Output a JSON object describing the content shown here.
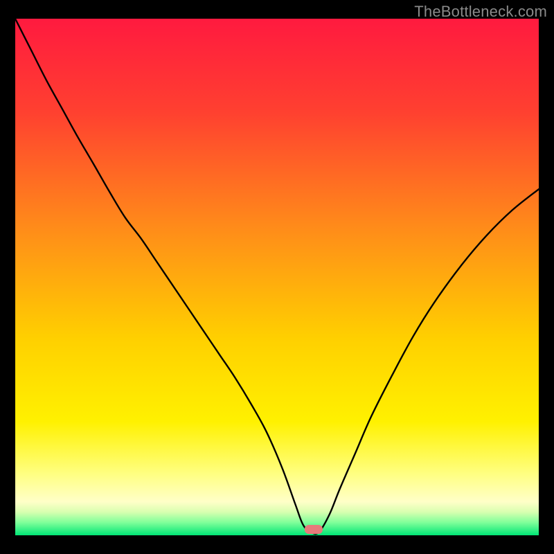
{
  "watermark": "TheBottleneck.com",
  "marker_color": "#e77b7b",
  "chart_data": {
    "type": "line",
    "title": "",
    "xlabel": "",
    "ylabel": "",
    "xlim": [
      0,
      100
    ],
    "ylim": [
      0,
      100
    ],
    "x": [
      0,
      3,
      6,
      9,
      12,
      15,
      18,
      21,
      24,
      27,
      30,
      33,
      36,
      39,
      42,
      45,
      48,
      51,
      53.5,
      55,
      56.5,
      58,
      60,
      62,
      65,
      68,
      72,
      76,
      80,
      85,
      90,
      95,
      100
    ],
    "values": [
      100,
      94,
      88,
      82.5,
      77,
      71.8,
      66.5,
      61.5,
      57.5,
      53,
      48.5,
      44,
      39.5,
      35,
      30.5,
      25.5,
      20,
      13,
      6,
      2,
      0.6,
      0.6,
      4,
      9,
      16,
      23,
      31,
      38.5,
      45,
      52,
      58,
      63,
      67
    ],
    "optimal_x": 57,
    "grid": false,
    "legend": false
  }
}
